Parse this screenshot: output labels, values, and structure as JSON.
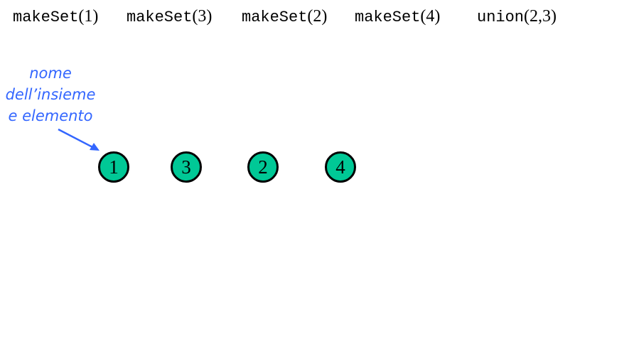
{
  "operations": [
    {
      "fn": "makeSet",
      "args": "(1)"
    },
    {
      "fn": "makeSet",
      "args": "(3)"
    },
    {
      "fn": "makeSet",
      "args": "(2)"
    },
    {
      "fn": "makeSet",
      "args": "(4)"
    },
    {
      "fn": "union",
      "args": "(2,3)"
    }
  ],
  "annotation": {
    "line1": "nome",
    "line2": "dell’insieme",
    "line3": "e elemento",
    "color": "#3366ff"
  },
  "nodes": [
    {
      "label": "1"
    },
    {
      "label": "3"
    },
    {
      "label": "2"
    },
    {
      "label": "4"
    }
  ],
  "node_color": "#00c896"
}
